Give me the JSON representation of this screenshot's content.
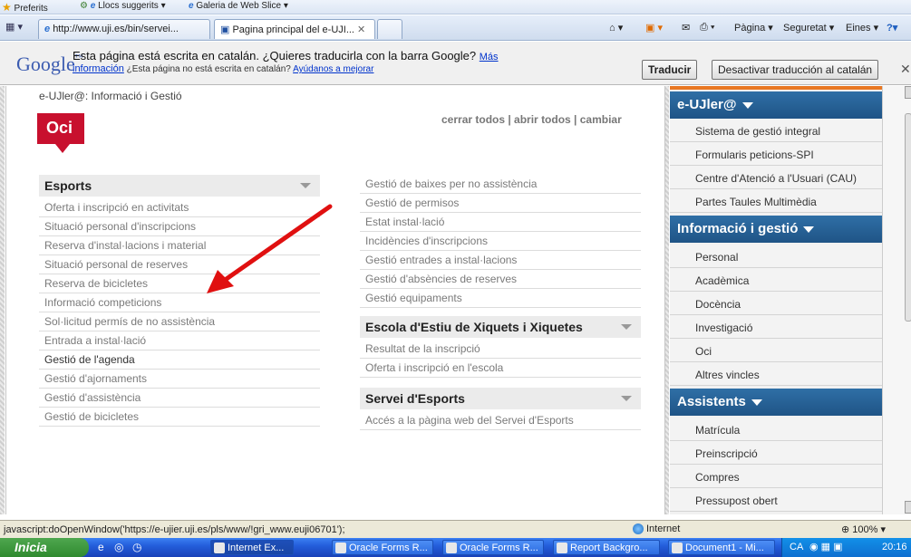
{
  "favorites_bar": {
    "favorites": "Preferits",
    "suggested": "Llocs suggerits ▾",
    "web_slice": "Galeria de Web Slice ▾"
  },
  "tabs": [
    {
      "label": "http://www.uji.es/bin/servei..."
    },
    {
      "label": "Pagina principal del e-UJI..."
    }
  ],
  "command_bar": {
    "page": "Pàgina ▾",
    "safety": "Seguretat ▾",
    "tools": "Eines ▾",
    "help": "?▾"
  },
  "translate_bar": {
    "logo": "Google",
    "message": "Esta página está escrita en catalán. ¿Quieres traducirla con la barra Google?",
    "more_link": "Más",
    "info_link": "información",
    "note": "¿Esta página no está escrita en catalán?",
    "help_link": "Ayúdanos a mejorar",
    "translate_btn": "Traducir",
    "disable_btn": "Desactivar traducción al catalán"
  },
  "page": {
    "breadcrumb": "e-UJler@: Informació i Gestió",
    "section_badge": "Oci",
    "links": "cerrar todos | abrir todos | cambiar",
    "left_section": {
      "title": "Esports",
      "items": [
        "Oferta i inscripció en activitats",
        "Situació personal d'inscripcions",
        "Reserva d'instal·lacions i material",
        "Situació personal de reserves",
        "Reserva de bicicletes",
        "Informació competicions",
        "Sol·licitud permís de no assistència",
        "Entrada a instal·lació",
        "Gestió de l'agenda",
        "Gestió d'ajornaments",
        "Gestió d'assistència",
        "Gestió de bicicletes"
      ]
    },
    "right_items": [
      "Gestió de baixes per no assistència",
      "Gestió de permisos",
      "Estat instal·lació",
      "Incidències d'inscripcions",
      "Gestió entrades a instal·lacions",
      "Gestió d'absències de reserves",
      "Gestió equipaments"
    ],
    "escola": {
      "title": "Escola d'Estiu de Xiquets i Xiquetes",
      "items": [
        "Resultat de la inscripció",
        "Oferta i inscripció en l'escola"
      ]
    },
    "servei": {
      "title": "Servei d'Esports",
      "items": [
        "Accés a la pàgina web del Servei d'Esports"
      ]
    }
  },
  "sidebar": {
    "groups": [
      {
        "title": "e-UJler@",
        "items": [
          "Sistema de gestió integral",
          "Formularis peticions-SPI",
          "Centre d'Atenció a l'Usuari (CAU)",
          "Partes Taules Multimèdia"
        ]
      },
      {
        "title": "Informació i gestió",
        "items": [
          "Personal",
          "Acadèmica",
          "Docència",
          "Investigació",
          "Oci",
          "Altres vincles"
        ]
      },
      {
        "title": "Assistents",
        "items": [
          "Matrícula",
          "Preinscripció",
          "Compres",
          "Pressupost obert"
        ]
      }
    ]
  },
  "status_bar": {
    "url": "javascript:doOpenWindow('https://e-ujier.uji.es/pls/www/!gri_www.euji06701');",
    "zone": "Internet",
    "zoom": "100%"
  },
  "taskbar": {
    "start": "Inicia",
    "buttons": [
      "Internet Ex...",
      "Oracle Forms R...",
      "Oracle Forms R...",
      "Report Backgro...",
      "Document1 - Mi..."
    ],
    "lang": "CA",
    "clock": "20:16"
  },
  "colors": {
    "brand_red": "#c8102e",
    "sidebar_blue": "#1f5486",
    "accent_orange": "#e87722",
    "arrow_red": "#e01010"
  }
}
